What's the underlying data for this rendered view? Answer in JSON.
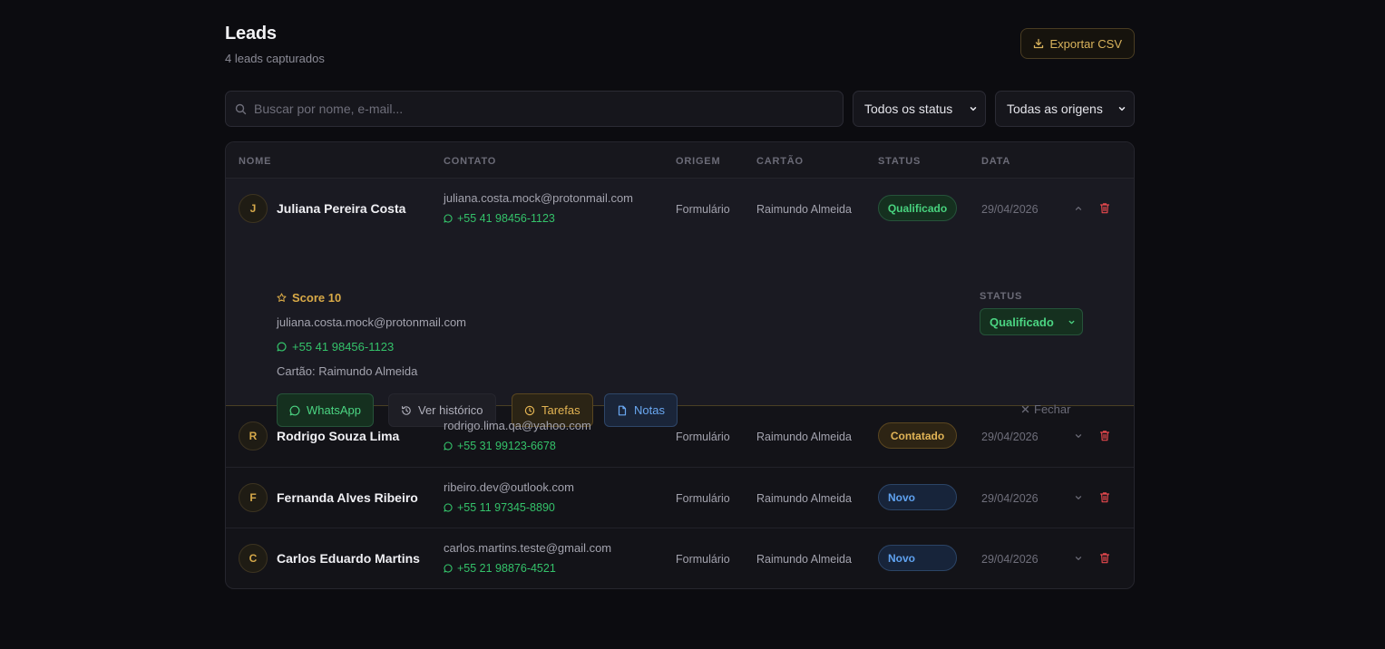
{
  "header": {
    "title": "Leads",
    "subtitle": "4 leads capturados",
    "export_label": "Exportar CSV"
  },
  "filters": {
    "search_placeholder": "Buscar por nome, e-mail...",
    "status_selected": "Todos os status",
    "origin_selected": "Todas as origens"
  },
  "table": {
    "columns": [
      "NOME",
      "CONTATO",
      "ORIGEM",
      "CARTÃO",
      "STATUS",
      "DATA"
    ],
    "rows": [
      {
        "initial": "J",
        "name": "Juliana Pereira Costa",
        "email": "juliana.costa.mock@protonmail.com",
        "phone": "+55 41 98456-1123",
        "origin": "Formulário",
        "card": "Raimundo Almeida",
        "status": "Qualificado",
        "date": "29/04/2026"
      },
      {
        "initial": "R",
        "name": "Rodrigo Souza Lima",
        "email": "rodrigo.lima.qa@yahoo.com",
        "phone": "+55 31 99123-6678",
        "origin": "Formulário",
        "card": "Raimundo Almeida",
        "status": "Contatado",
        "date": "29/04/2026"
      },
      {
        "initial": "F",
        "name": "Fernanda Alves Ribeiro",
        "email": "ribeiro.dev@outlook.com",
        "phone": "+55 11 97345-8890",
        "origin": "Formulário",
        "card": "Raimundo Almeida",
        "status": "Novo",
        "date": "29/04/2026"
      },
      {
        "initial": "C",
        "name": "Carlos Eduardo Martins",
        "email": "carlos.martins.teste@gmail.com",
        "phone": "+55 21 98876-4521",
        "origin": "Formulário",
        "card": "Raimundo Almeida",
        "status": "Novo",
        "date": "29/04/2026"
      }
    ]
  },
  "expanded": {
    "score": "Score 10",
    "email": "juliana.costa.mock@protonmail.com",
    "phone": "+55 41 98456-1123",
    "card": "Cartão: Raimundo Almeida",
    "status_label": "STATUS",
    "status_value": "Qualificado",
    "actions": {
      "whatsapp": "WhatsApp",
      "history": "Ver histórico",
      "tasks": "Tarefas",
      "notes": "Notas"
    },
    "close_label": "Fechar"
  },
  "icons": {
    "export": "download-icon",
    "search": "search-icon",
    "phone": "whatsapp-icon",
    "score": "star-icon",
    "history": "history-icon",
    "tasks": "clock-icon",
    "notes": "file-icon",
    "delete": "trash-icon",
    "expand": "chevron-icon",
    "close": "close-icon"
  },
  "colors": {
    "background": "#0c0c10",
    "accent": "#d9b35c",
    "qualified": "#48d27e",
    "contacted": "#e1b456",
    "new": "#5fa2f0",
    "delete": "#e5484d"
  }
}
